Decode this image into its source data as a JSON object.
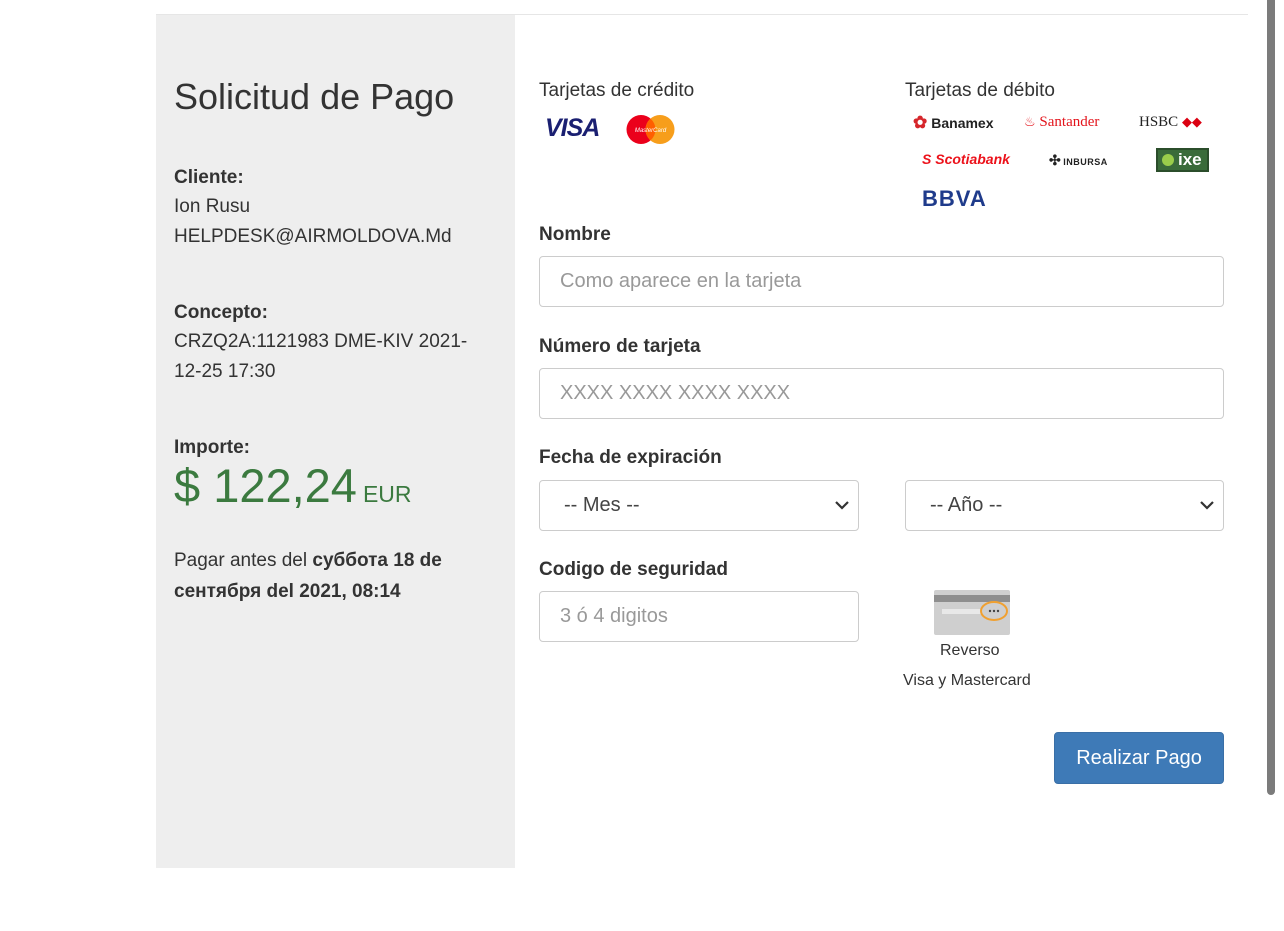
{
  "summary": {
    "title": "Solicitud de Pago",
    "client_label": "Cliente:",
    "client_name": "Ion Rusu",
    "client_email": "HELPDESK@AIRMOLDOVA.Md",
    "concept_label": "Concepto:",
    "concept_line1": "CRZQ2A:1121983 DME-KIV 2021-",
    "concept_line2": "12-25 17:30",
    "amount_label": "Importe:",
    "amount": "$ 122,24",
    "currency": "EUR",
    "pay_before_prefix": "Pagar antes del ",
    "pay_before_date": "субботa 18 de сентября del 2021, 08:14"
  },
  "cards": {
    "credit_label": "Tarjetas de crédito",
    "debit_label": "Tarjetas de débito",
    "credit_logos": [
      "VISA",
      "MasterCard"
    ],
    "debit_logos": [
      "Banamex",
      "Santander",
      "HSBC",
      "Scotiabank",
      "INBURSA",
      "ixe",
      "BBVA"
    ]
  },
  "form": {
    "name_label": "Nombre",
    "name_placeholder": "Como aparece en la tarjeta",
    "number_label": "Número de tarjeta",
    "number_placeholder": "XXXX XXXX XXXX XXXX",
    "expiry_label": "Fecha de expiración",
    "month_selected": "-- Mes --",
    "year_selected": "-- Año --",
    "cvv_label": "Codigo de seguridad",
    "cvv_placeholder": "3 ó 4 digitos",
    "cvv_hint_line1": "Reverso",
    "cvv_hint_line2": "Visa y Mastercard",
    "submit_label": "Realizar Pago"
  },
  "colors": {
    "sidebar_bg": "#eeeeee",
    "amount_green": "#3b7a3f",
    "button_blue": "#3e7ab7"
  },
  "icons": {
    "select_arrow": "chevron-down-icon",
    "cvv_hint": "card-back-icon"
  }
}
